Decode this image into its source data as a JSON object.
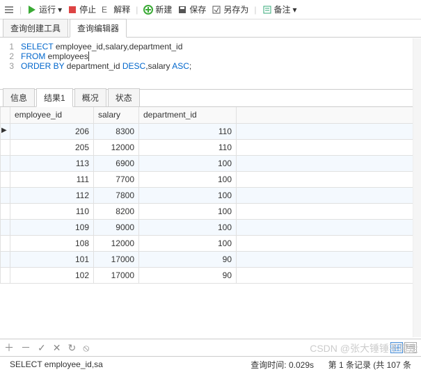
{
  "toolbar": {
    "run": "运行",
    "stop": "停止",
    "explain": "解释",
    "new": "新建",
    "save": "保存",
    "saveAs": "另存为",
    "notes": "备注"
  },
  "topTabs": {
    "builder": "查询创建工具",
    "editor": "查询编辑器"
  },
  "sql": {
    "lines": [
      {
        "n": "1",
        "pre": "SELECT ",
        "body": "employee_id,salary,department_id"
      },
      {
        "n": "2",
        "pre": "FROM ",
        "body": "employees"
      },
      {
        "n": "3",
        "pre": "ORDER BY ",
        "body": "department_id ",
        "k2": "DESC",
        "body2": ",salary ",
        "k3": "ASC",
        "body3": ";"
      }
    ]
  },
  "midTabs": {
    "info": "信息",
    "result": "结果1",
    "profile": "概况",
    "status": "状态"
  },
  "grid": {
    "headers": {
      "c1": "employee_id",
      "c2": "salary",
      "c3": "department_id"
    },
    "rows": [
      {
        "c1": "206",
        "c2": "8300",
        "c3": "110"
      },
      {
        "c1": "205",
        "c2": "12000",
        "c3": "110"
      },
      {
        "c1": "113",
        "c2": "6900",
        "c3": "100"
      },
      {
        "c1": "111",
        "c2": "7700",
        "c3": "100"
      },
      {
        "c1": "112",
        "c2": "7800",
        "c3": "100"
      },
      {
        "c1": "110",
        "c2": "8200",
        "c3": "100"
      },
      {
        "c1": "109",
        "c2": "9000",
        "c3": "100"
      },
      {
        "c1": "108",
        "c2": "12000",
        "c3": "100"
      },
      {
        "c1": "101",
        "c2": "17000",
        "c3": "90"
      },
      {
        "c1": "102",
        "c2": "17000",
        "c3": "90"
      }
    ]
  },
  "status": {
    "sql": "SELECT employee_id,sa",
    "time": "查询时间: 0.029s",
    "rec": "第 1 条记录 (共 107 条"
  },
  "watermark": "CSDN @张大锤锤不带走"
}
